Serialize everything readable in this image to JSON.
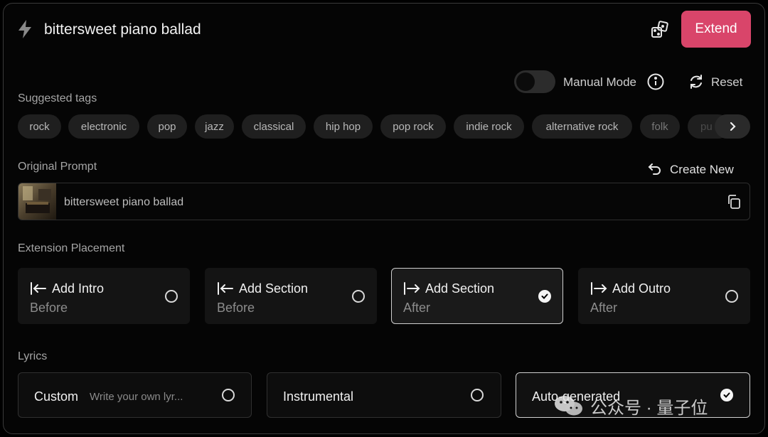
{
  "header": {
    "title": "bittersweet piano ballad",
    "extend_label": "Extend",
    "accent_color": "#d9456a",
    "icons": [
      "bolt-icon",
      "dice-icon"
    ]
  },
  "controls": {
    "manual_mode_label": "Manual Mode",
    "manual_mode_on": false,
    "reset_label": "Reset"
  },
  "suggested_tags": {
    "label": "Suggested tags",
    "tags": [
      "rock",
      "electronic",
      "pop",
      "jazz",
      "classical",
      "hip hop",
      "pop rock",
      "indie rock",
      "alternative rock",
      "folk",
      "pu"
    ]
  },
  "original_prompt": {
    "label": "Original Prompt",
    "create_new_label": "Create New",
    "text": "bittersweet piano ballad"
  },
  "extension_placement": {
    "label": "Extension Placement",
    "options": [
      {
        "title": "Add Intro",
        "sub": "Before",
        "selected": false
      },
      {
        "title": "Add Section",
        "sub": "Before",
        "selected": false
      },
      {
        "title": "Add Section",
        "sub": "After",
        "selected": true
      },
      {
        "title": "Add Outro",
        "sub": "After",
        "selected": false
      }
    ]
  },
  "lyrics": {
    "label": "Lyrics",
    "options": [
      {
        "title": "Custom",
        "hint": "Write your own lyr...",
        "selected": false
      },
      {
        "title": "Instrumental",
        "selected": false
      },
      {
        "title": "Auto-generated",
        "selected": true
      }
    ]
  },
  "watermark": {
    "text": "公众号 · 量子位"
  }
}
